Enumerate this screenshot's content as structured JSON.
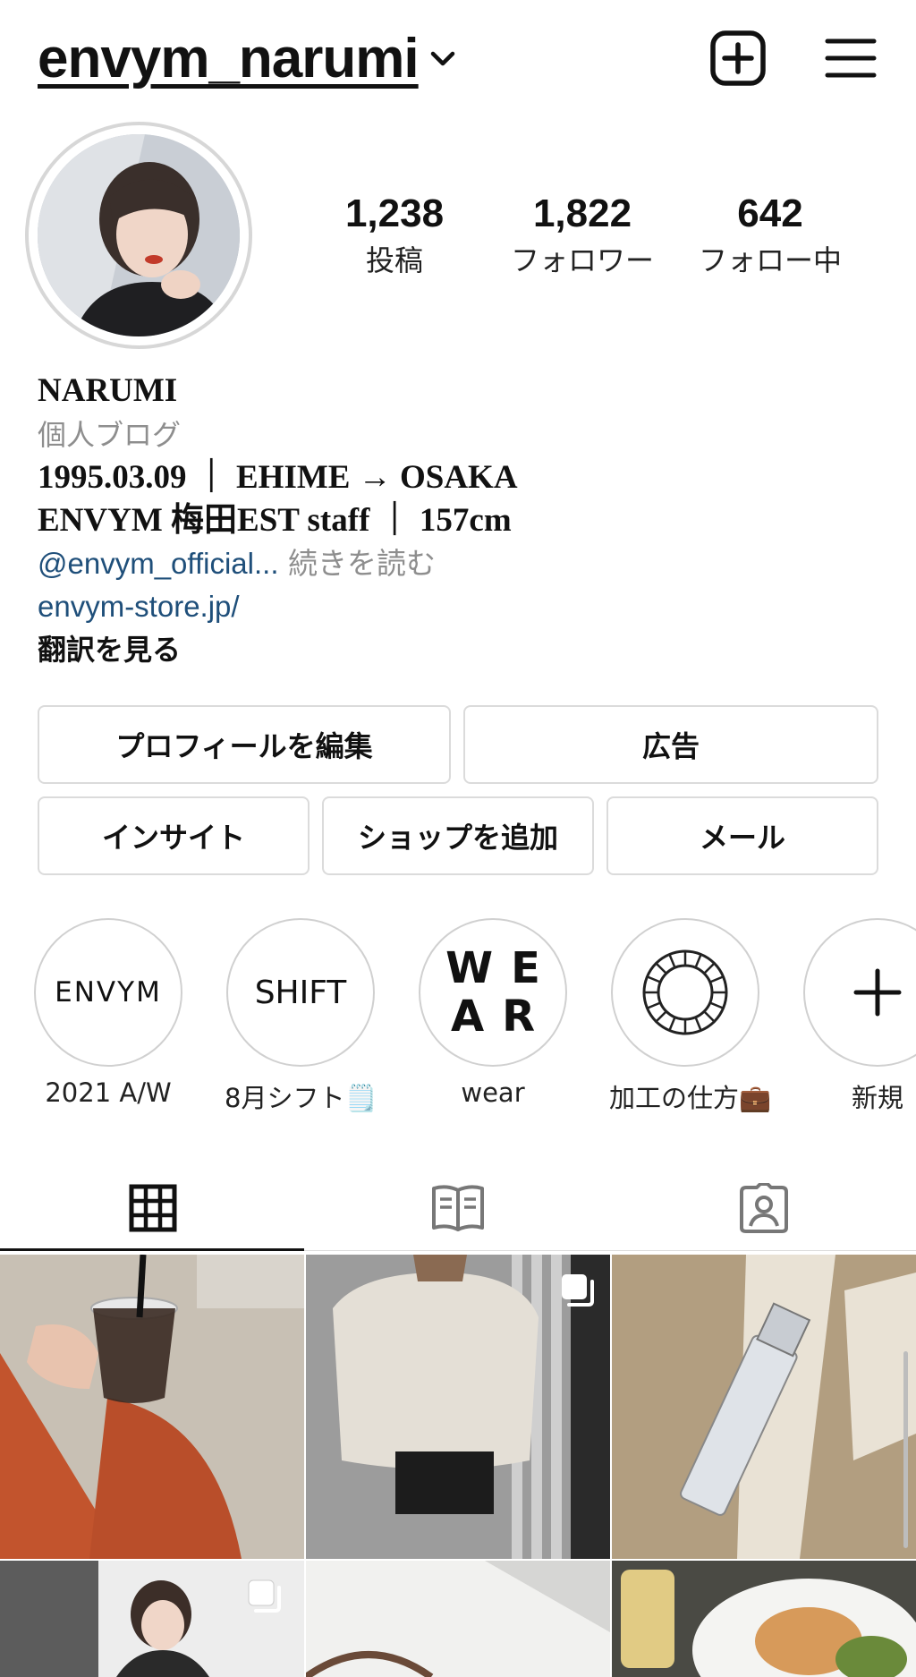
{
  "header": {
    "username": "envym_narumi",
    "icons": [
      "chevron-down-icon",
      "new-post-icon",
      "menu-icon"
    ]
  },
  "profile": {
    "stats": [
      {
        "value": "1,238",
        "label": "投稿"
      },
      {
        "value": "1,822",
        "label": "フォロワー"
      },
      {
        "value": "642",
        "label": "フォロー中"
      }
    ]
  },
  "bio": {
    "name": "NARUMI",
    "category": "個人ブログ",
    "line1": "1995.03.09 ｜ EHIME → OSAKA",
    "line2": "ENVYM 梅田EST staff ｜ 157cm",
    "mention": "@envym_official...",
    "read_more": " 続きを読む",
    "link": "envym-store.jp/",
    "translate": "翻訳を見る"
  },
  "buttons": {
    "edit_profile": "プロフィールを編集",
    "ads": "広告",
    "insights": "インサイト",
    "add_shop": "ショップを追加",
    "email": "メール"
  },
  "highlights": [
    {
      "cover_text": "ENVYM",
      "label": "2021 A/W"
    },
    {
      "cover_text": "SHIFT",
      "label": "8月シフト🗒️"
    },
    {
      "cover_text_line1": "WE",
      "cover_text_line2": "AR",
      "label": "wear"
    },
    {
      "cover_icon": "ring-pattern-icon",
      "label": "加工の仕方💼"
    },
    {
      "cover_icon": "plus-icon",
      "label": "新規"
    }
  ],
  "tabs": [
    {
      "icon": "grid-icon",
      "active": true
    },
    {
      "icon": "guide-book-icon",
      "active": false
    },
    {
      "icon": "tagged-person-icon",
      "active": false
    }
  ],
  "grid_posts": [
    {
      "subject": "iced-coffee-photo",
      "multi": false
    },
    {
      "subject": "sweatshirt-photo",
      "multi": true
    },
    {
      "subject": "zara-perfume-photo",
      "multi": false
    },
    {
      "subject": "portrait-photo",
      "multi": true
    },
    {
      "subject": "chair-shadow-photo",
      "multi": false
    },
    {
      "subject": "food-plate-photo",
      "multi": false
    }
  ],
  "colors": {
    "link": "#1f4f7a",
    "secondary_text": "#8e8e8e",
    "border": "#dbdbdb"
  }
}
